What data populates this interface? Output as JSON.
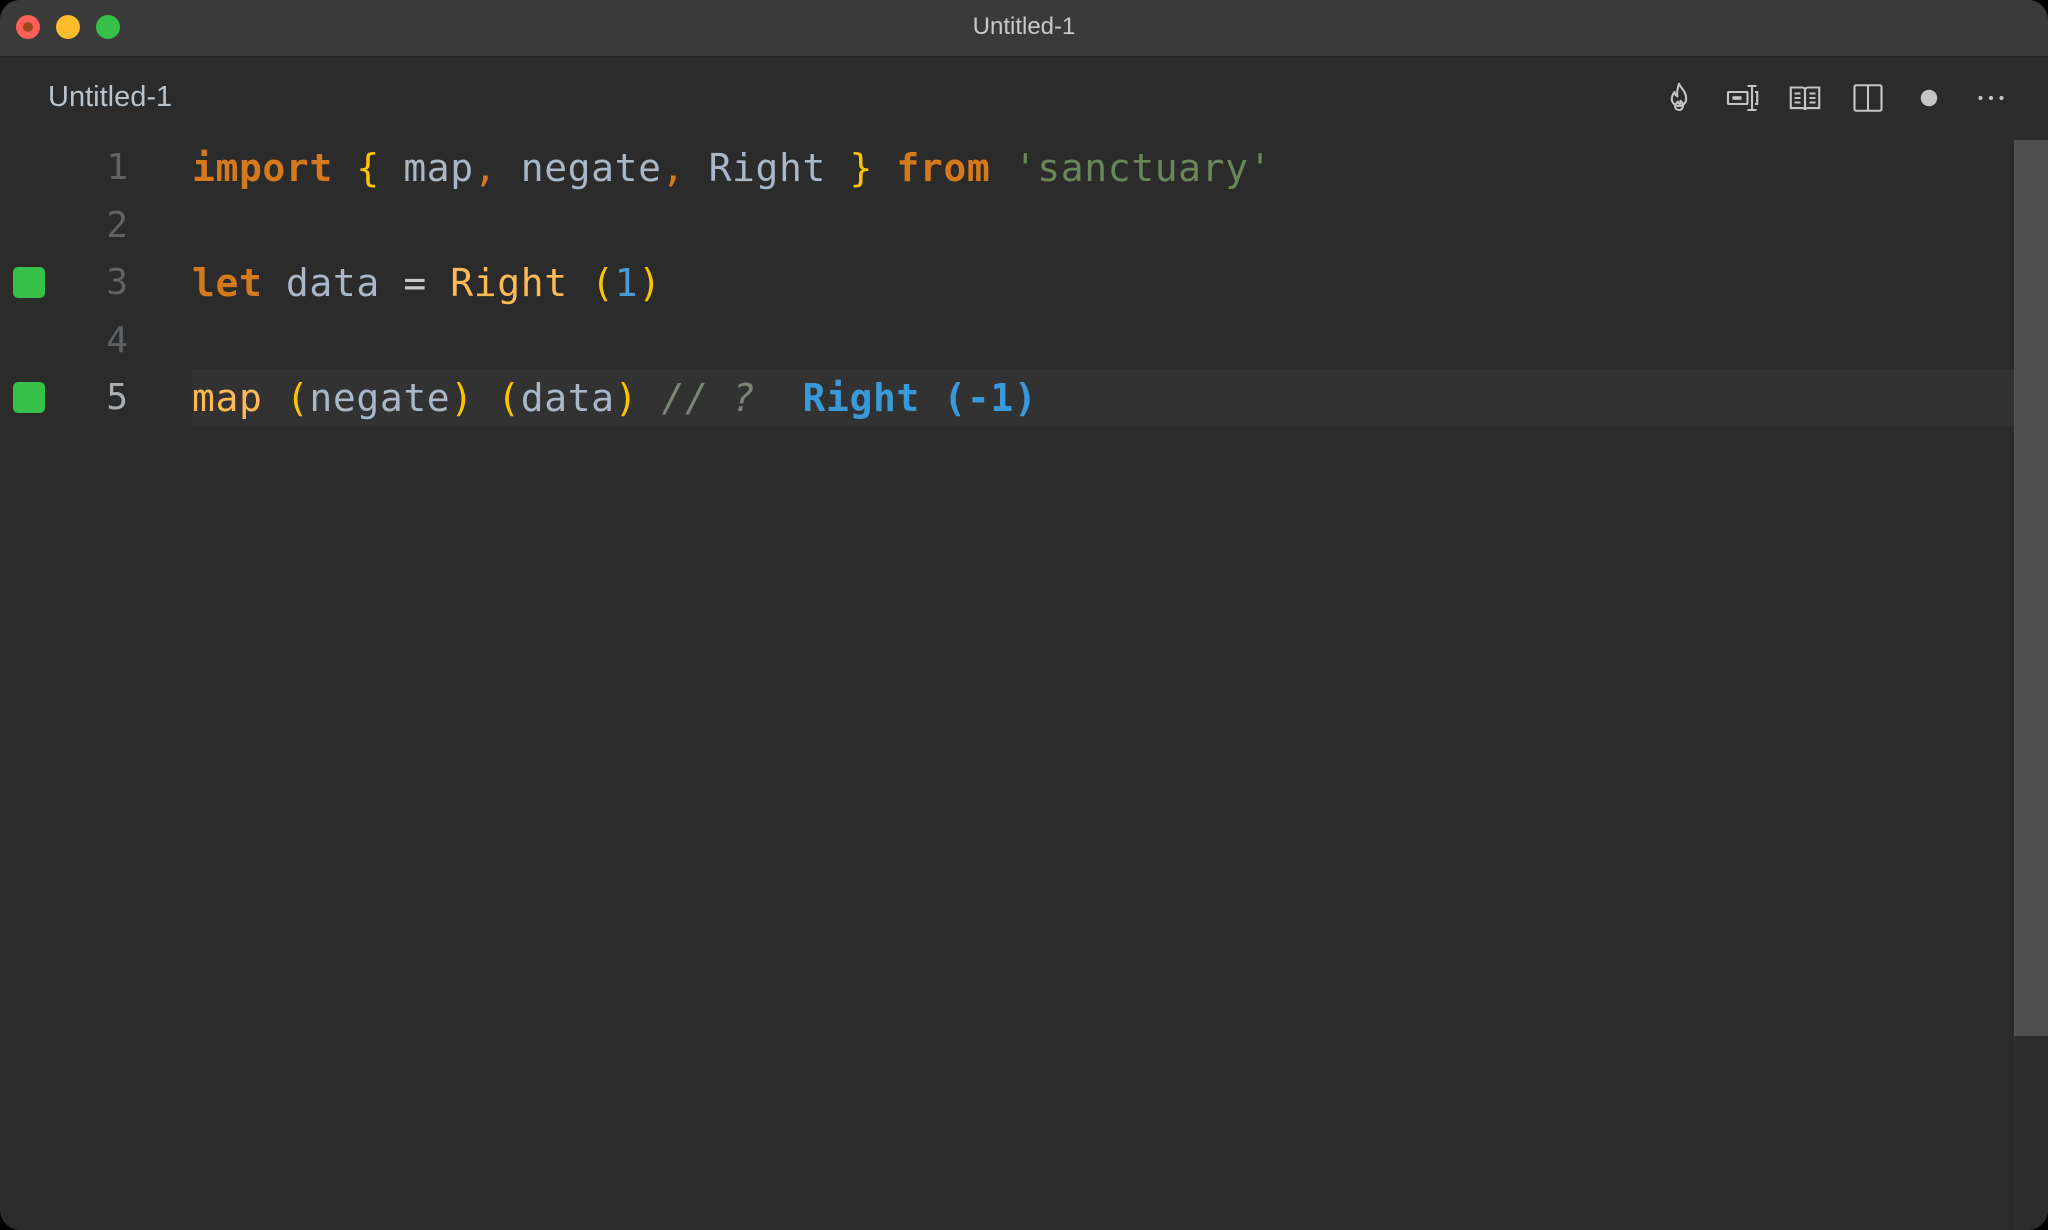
{
  "window": {
    "title": "Untitled-1"
  },
  "tab": {
    "label": "Untitled-1",
    "dirty": true
  },
  "toolbar": {
    "actions": [
      {
        "name": "quokka-flame-icon",
        "label": "Quokka"
      },
      {
        "name": "live-share-icon",
        "label": "Toggle live value"
      },
      {
        "name": "open-preview-icon",
        "label": "Open Preview"
      },
      {
        "name": "split-editor-icon",
        "label": "Split Editor"
      },
      {
        "name": "unsaved-dot-icon",
        "label": "Unsaved changes"
      },
      {
        "name": "more-actions-icon",
        "label": "More Actions"
      }
    ]
  },
  "editor": {
    "language": "javascript",
    "current_line": 5,
    "lines": [
      {
        "number": "1",
        "marker": false,
        "tokens": [
          {
            "t": "import",
            "c": "kw"
          },
          {
            "t": " ",
            "c": "ident"
          },
          {
            "t": "{",
            "c": "brace"
          },
          {
            "t": " map",
            "c": "ident"
          },
          {
            "t": ",",
            "c": "punct"
          },
          {
            "t": " negate",
            "c": "ident"
          },
          {
            "t": ",",
            "c": "punct"
          },
          {
            "t": " Right ",
            "c": "ident"
          },
          {
            "t": "}",
            "c": "brace"
          },
          {
            "t": " ",
            "c": "ident"
          },
          {
            "t": "from",
            "c": "kw"
          },
          {
            "t": " ",
            "c": "ident"
          },
          {
            "t": "'sanctuary'",
            "c": "str"
          }
        ]
      },
      {
        "number": "2",
        "marker": false,
        "tokens": []
      },
      {
        "number": "3",
        "marker": true,
        "tokens": [
          {
            "t": "let",
            "c": "kw"
          },
          {
            "t": " data ",
            "c": "ident"
          },
          {
            "t": "=",
            "c": "op"
          },
          {
            "t": " ",
            "c": "ident"
          },
          {
            "t": "Right",
            "c": "fn"
          },
          {
            "t": " ",
            "c": "ident"
          },
          {
            "t": "(",
            "c": "brace"
          },
          {
            "t": "1",
            "c": "num"
          },
          {
            "t": ")",
            "c": "brace"
          }
        ]
      },
      {
        "number": "4",
        "marker": false,
        "tokens": []
      },
      {
        "number": "5",
        "marker": true,
        "tokens": [
          {
            "t": "map",
            "c": "fn"
          },
          {
            "t": " ",
            "c": "ident"
          },
          {
            "t": "(",
            "c": "brace"
          },
          {
            "t": "negate",
            "c": "ident"
          },
          {
            "t": ")",
            "c": "brace"
          },
          {
            "t": " ",
            "c": "ident"
          },
          {
            "t": "(",
            "c": "brace"
          },
          {
            "t": "data",
            "c": "ident"
          },
          {
            "t": ")",
            "c": "brace"
          },
          {
            "t": " ",
            "c": "ident"
          },
          {
            "t": "// ?",
            "c": "comment"
          },
          {
            "t": "  ",
            "c": "ident"
          },
          {
            "t": "Right (-1)",
            "c": "result"
          }
        ]
      }
    ]
  },
  "colors": {
    "marker_green": "#36c048",
    "keyword": "#d5791d",
    "brace": "#fdc400",
    "string": "#6a8759",
    "number": "#4a9ad6",
    "function": "#ffb955",
    "result": "#3a9ad9",
    "background": "#2b2b2b"
  }
}
